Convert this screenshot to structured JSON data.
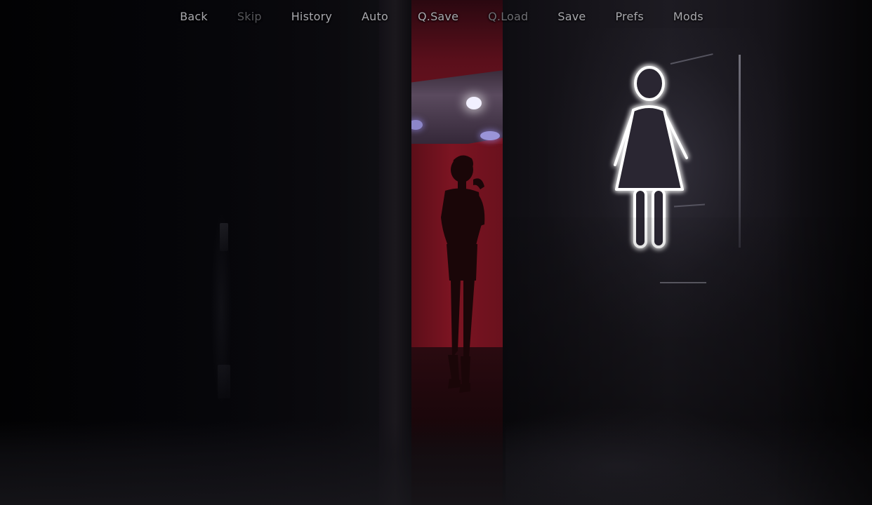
{
  "quick_menu": {
    "items": [
      {
        "label": "Back",
        "state": "enabled"
      },
      {
        "label": "Skip",
        "state": "disabled"
      },
      {
        "label": "History",
        "state": "enabled"
      },
      {
        "label": "Auto",
        "state": "enabled"
      },
      {
        "label": "Q.Save",
        "state": "enabled"
      },
      {
        "label": "Q.Load",
        "state": "dim"
      },
      {
        "label": "Save",
        "state": "enabled"
      },
      {
        "label": "Prefs",
        "state": "enabled"
      },
      {
        "label": "Mods",
        "state": "enabled"
      }
    ]
  },
  "scene": {
    "sign_icon": "female-restroom-icon",
    "neon_color": "#ffffff",
    "doorway_color": "#8a1828"
  }
}
